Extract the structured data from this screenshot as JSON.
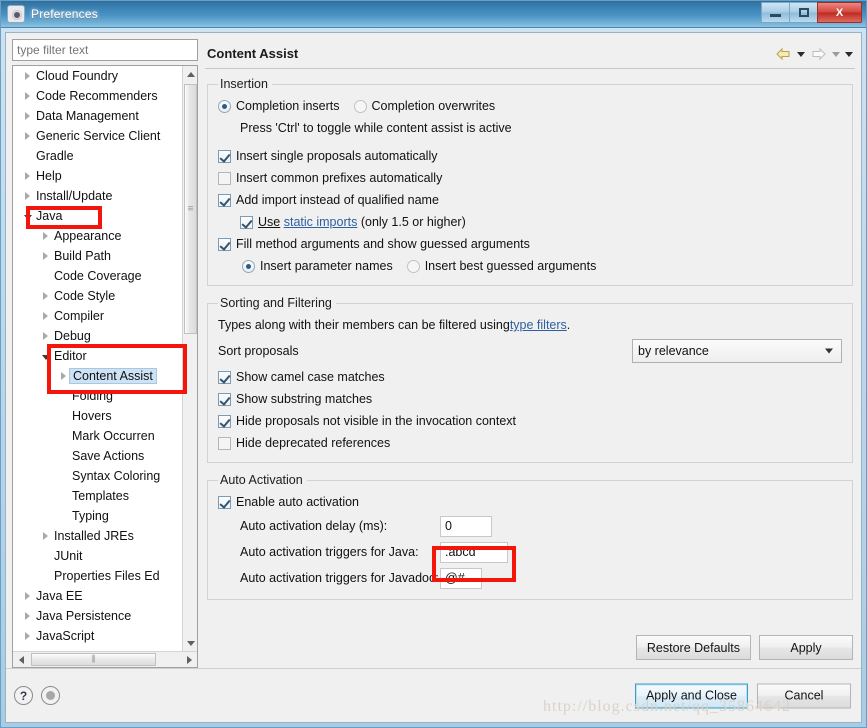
{
  "window": {
    "title": "Preferences",
    "icon": "eclipse-gear-icon",
    "controls": {
      "minimize": "Minimize",
      "maximize": "Maximize",
      "close": "X"
    }
  },
  "sidebar": {
    "filter": {
      "placeholder": "type filter text",
      "value": ""
    },
    "items": [
      {
        "label": "Cloud Foundry",
        "indent": 0,
        "arrow": "collapsed",
        "selected": false
      },
      {
        "label": "Code Recommenders",
        "indent": 0,
        "arrow": "collapsed",
        "selected": false
      },
      {
        "label": "Data Management",
        "indent": 0,
        "arrow": "collapsed",
        "selected": false
      },
      {
        "label": "Generic Service Client",
        "indent": 0,
        "arrow": "collapsed",
        "selected": false
      },
      {
        "label": "Gradle",
        "indent": 0,
        "arrow": "none",
        "selected": false
      },
      {
        "label": "Help",
        "indent": 0,
        "arrow": "collapsed",
        "selected": false
      },
      {
        "label": "Install/Update",
        "indent": 0,
        "arrow": "collapsed",
        "selected": false
      },
      {
        "label": "Java",
        "indent": 0,
        "arrow": "expanded",
        "selected": false
      },
      {
        "label": "Appearance",
        "indent": 1,
        "arrow": "collapsed",
        "selected": false
      },
      {
        "label": "Build Path",
        "indent": 1,
        "arrow": "collapsed",
        "selected": false
      },
      {
        "label": "Code Coverage",
        "indent": 1,
        "arrow": "none",
        "selected": false
      },
      {
        "label": "Code Style",
        "indent": 1,
        "arrow": "collapsed",
        "selected": false
      },
      {
        "label": "Compiler",
        "indent": 1,
        "arrow": "collapsed",
        "selected": false
      },
      {
        "label": "Debug",
        "indent": 1,
        "arrow": "collapsed",
        "selected": false
      },
      {
        "label": "Editor",
        "indent": 1,
        "arrow": "expanded",
        "selected": false
      },
      {
        "label": "Content Assist",
        "indent": 2,
        "arrow": "collapsed",
        "selected": true
      },
      {
        "label": "Folding",
        "indent": 2,
        "arrow": "none",
        "selected": false
      },
      {
        "label": "Hovers",
        "indent": 2,
        "arrow": "none",
        "selected": false
      },
      {
        "label": "Mark Occurren",
        "indent": 2,
        "arrow": "none",
        "selected": false
      },
      {
        "label": "Save Actions",
        "indent": 2,
        "arrow": "none",
        "selected": false
      },
      {
        "label": "Syntax Coloring",
        "indent": 2,
        "arrow": "none",
        "selected": false
      },
      {
        "label": "Templates",
        "indent": 2,
        "arrow": "none",
        "selected": false
      },
      {
        "label": "Typing",
        "indent": 2,
        "arrow": "none",
        "selected": false
      },
      {
        "label": "Installed JREs",
        "indent": 1,
        "arrow": "collapsed",
        "selected": false
      },
      {
        "label": "JUnit",
        "indent": 1,
        "arrow": "none",
        "selected": false
      },
      {
        "label": "Properties Files Ed",
        "indent": 1,
        "arrow": "none",
        "selected": false
      },
      {
        "label": "Java EE",
        "indent": 0,
        "arrow": "collapsed",
        "selected": false
      },
      {
        "label": "Java Persistence",
        "indent": 0,
        "arrow": "collapsed",
        "selected": false
      },
      {
        "label": "JavaScript",
        "indent": 0,
        "arrow": "collapsed",
        "selected": false
      }
    ]
  },
  "panel": {
    "title": "Content Assist",
    "nav": {
      "back_icon": "back-arrow-icon",
      "back_menu_icon": "chevron-down-icon",
      "forward_icon": "forward-arrow-icon",
      "forward_menu_icon": "chevron-down-icon",
      "view_menu_icon": "chevron-down-icon"
    },
    "insertion": {
      "legend": "Insertion",
      "completion_inserts": "Completion inserts",
      "completion_overwrites": "Completion overwrites",
      "hint": "Press 'Ctrl' to toggle while content assist is active",
      "insert_single": "Insert single proposals automatically",
      "insert_common_prefixes": "Insert common prefixes automatically",
      "add_import": "Add import instead of qualified name",
      "use_prefix": "Use",
      "static_imports_link": "static imports",
      "use_suffix": "(only 1.5 or higher)",
      "fill_method_args": "Fill method arguments and show guessed arguments",
      "insert_param_names": "Insert parameter names",
      "insert_best_guessed": "Insert best guessed arguments"
    },
    "sorting": {
      "legend": "Sorting and Filtering",
      "types_text_prefix": "Types along with their members can be filtered using ",
      "type_filters_link": "type filters",
      "types_text_suffix": ".",
      "sort_proposals_label": "Sort proposals",
      "sort_proposals_value": "by relevance",
      "show_camel_case": "Show camel case matches",
      "show_substring": "Show substring matches",
      "hide_not_visible": "Hide proposals not visible in the invocation context",
      "hide_deprecated": "Hide deprecated references"
    },
    "auto_activation": {
      "legend": "Auto Activation",
      "enable_label": "Enable auto activation",
      "delay_label": "Auto activation delay (ms):",
      "delay_value": "0",
      "java_triggers_label": "Auto activation triggers for Java:",
      "java_triggers_value": ".abcd",
      "javadoc_triggers_label": "Auto activation triggers for Javadoc:",
      "javadoc_triggers_value": "@#"
    },
    "buttons": {
      "restore_defaults": "Restore Defaults",
      "apply": "Apply"
    }
  },
  "footer": {
    "help_icon": "question-mark-icon",
    "status_icon": "grey-dot-icon",
    "apply_and_close": "Apply and Close",
    "cancel": "Cancel"
  },
  "watermark": "http://blog.csdn.net/qq_35864642",
  "colors": {
    "annotation_red": "#f5160b",
    "selection_blue": "#cde3f5",
    "link_blue": "#2e5fa3",
    "titlebar_blue": "#3d84b5",
    "close_red": "#d4453c"
  }
}
